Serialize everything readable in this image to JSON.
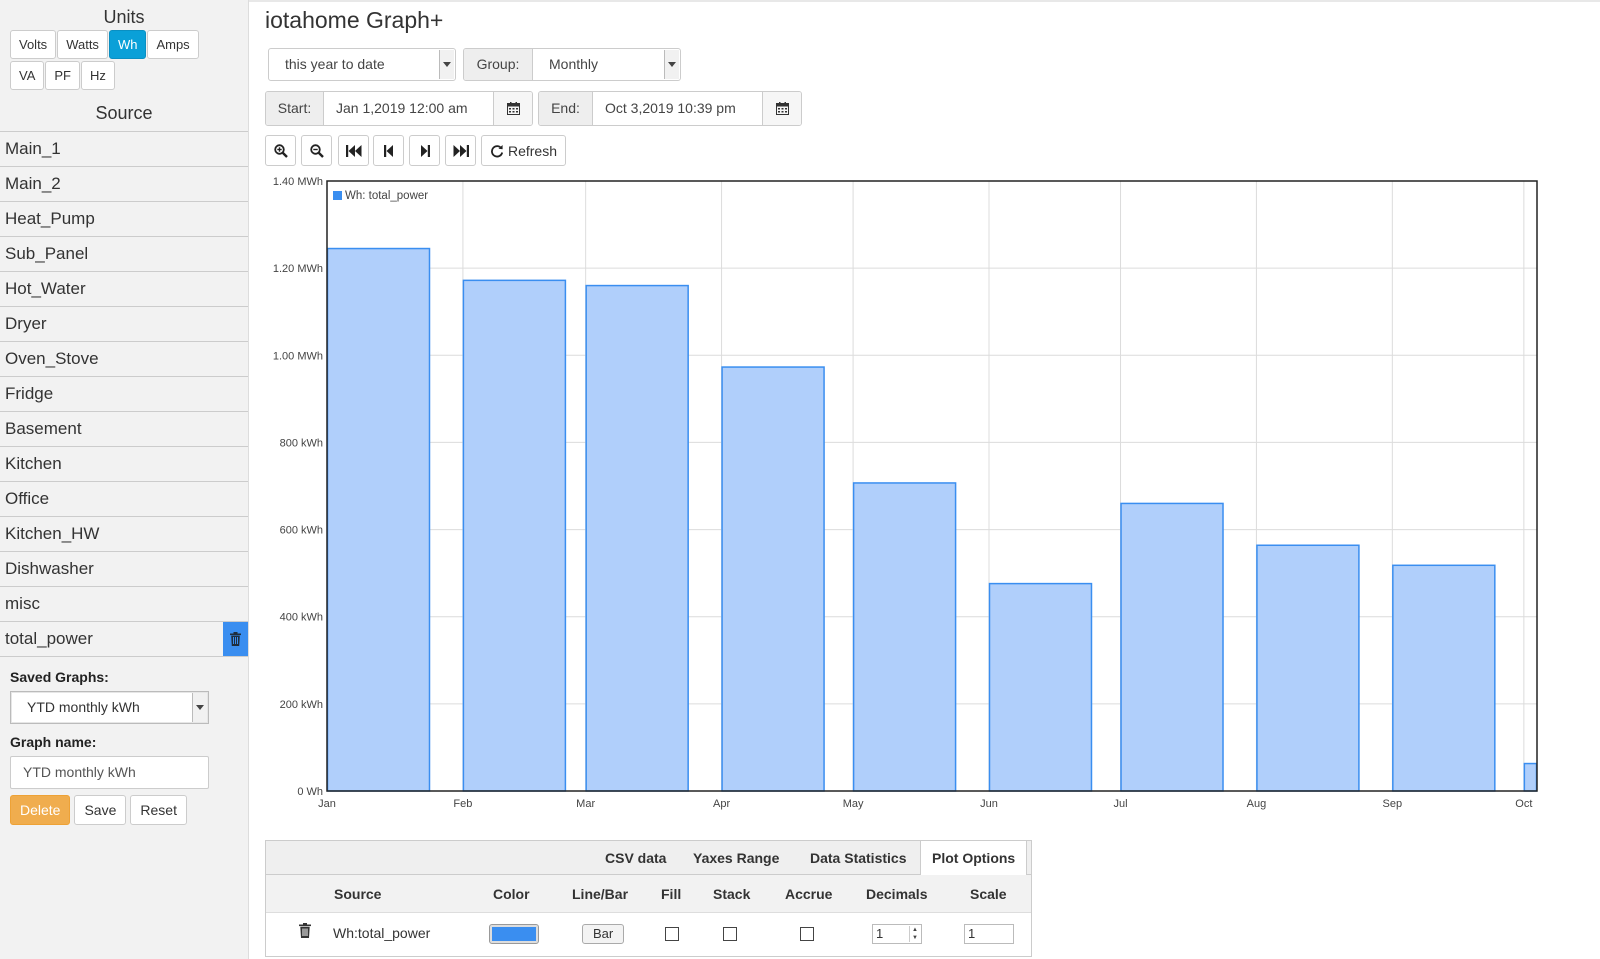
{
  "sidebar": {
    "units_heading": "Units",
    "units": [
      "Volts",
      "Watts",
      "Wh",
      "Amps",
      "VA",
      "PF",
      "Hz"
    ],
    "active_unit": "Wh",
    "source_heading": "Source",
    "sources": [
      "Main_1",
      "Main_2",
      "Heat_Pump",
      "Sub_Panel",
      "Hot_Water",
      "Dryer",
      "Oven_Stove",
      "Fridge",
      "Basement",
      "Kitchen",
      "Office",
      "Kitchen_HW",
      "Dishwasher",
      "misc",
      "total_power"
    ],
    "selected_source": "total_power",
    "saved_graphs_label": "Saved Graphs:",
    "saved_graph_value": "YTD monthly kWh",
    "graph_name_label": "Graph name:",
    "graph_name_value": "YTD monthly kWh",
    "delete_label": "Delete",
    "save_label": "Save",
    "reset_label": "Reset"
  },
  "header": {
    "title": "iotahome Graph+",
    "range_value": "this year to date",
    "group_label": "Group:",
    "group_value": "Monthly",
    "start_label": "Start:",
    "start_value": "Jan 1,2019 12:00 am",
    "end_label": "End:",
    "end_value": "Oct 3,2019 10:39 pm",
    "refresh_label": "Refresh"
  },
  "colors": {
    "accent": "#0aa0d8",
    "series": "#3a8ef0",
    "bar_fill": "#b0cffb",
    "danger": "#f0ad4e"
  },
  "chart_data": {
    "type": "bar",
    "categories": [
      "Jan",
      "Feb",
      "Mar",
      "Apr",
      "May",
      "Jun",
      "Jul",
      "Aug",
      "Sep",
      "Oct"
    ],
    "series": [
      {
        "name": "Wh: total_power",
        "values": [
          1245,
          1172,
          1160,
          973,
          707,
          476,
          660,
          564,
          518,
          63
        ]
      }
    ],
    "yticks": [
      0,
      200,
      400,
      600,
      800,
      1000,
      1200,
      1400
    ],
    "ytick_labels": [
      "0 Wh",
      "200 kWh",
      "400 kWh",
      "600 kWh",
      "800 kWh",
      "1.00 MWh",
      "1.20 MWh",
      "1.40 MWh"
    ],
    "ylim": [
      0,
      1400
    ],
    "yunit": "kWh",
    "xlabel": "",
    "ylabel": "",
    "grid": true,
    "legend": "top-left"
  },
  "options": {
    "tabs": [
      "CSV data",
      "Yaxes Range",
      "Data Statistics",
      "Plot Options"
    ],
    "active_tab": "Plot Options",
    "columns": [
      "Source",
      "Color",
      "Line/Bar",
      "Fill",
      "Stack",
      "Accrue",
      "Decimals",
      "Scale"
    ],
    "row": {
      "source": "Wh:total_power",
      "color": "#3a8ef0",
      "line_bar": "Bar",
      "fill": false,
      "stack": false,
      "accrue": false,
      "decimals": "1",
      "scale": "1"
    }
  }
}
